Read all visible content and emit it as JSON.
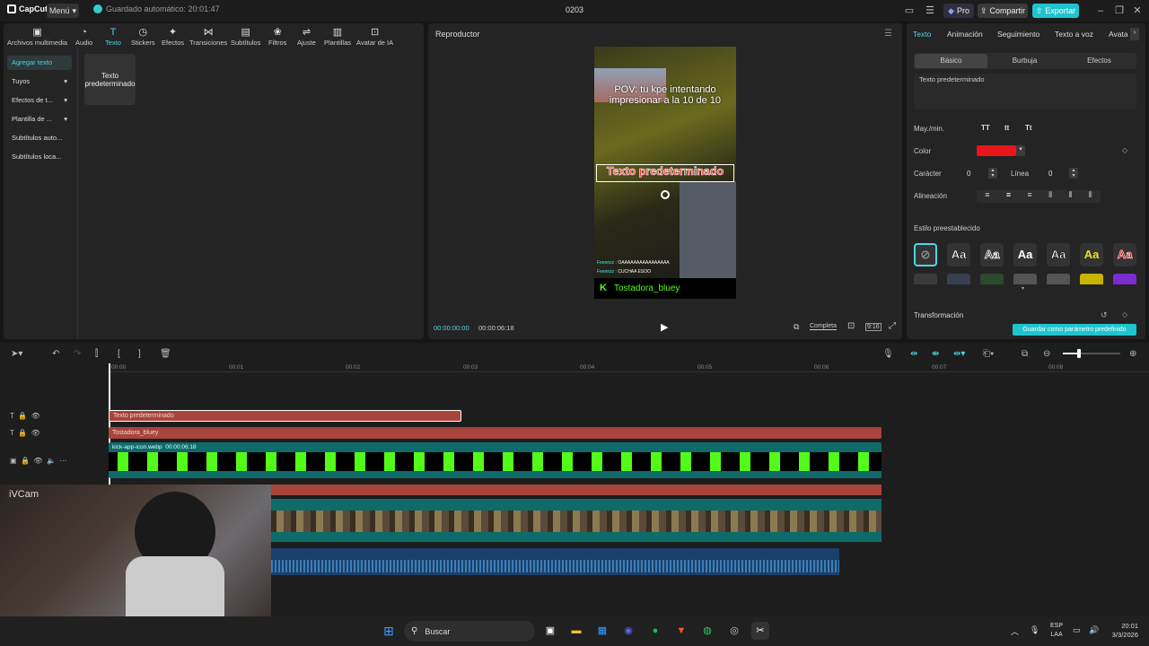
{
  "app": {
    "logo": "CapCut",
    "menu_label": "Menú",
    "autosave": "Guardado automático: 20:01:47",
    "project_name": "0203",
    "pro_label": "Pro",
    "share_label": "Compartir",
    "export_label": "Exportar"
  },
  "toolbar": {
    "items": [
      "Archivos multimedia",
      "Audio",
      "Texto",
      "Stickers",
      "Efectos",
      "Transiciones",
      "Subtítulos",
      "Filtros",
      "Ajuste",
      "Plantillas",
      "Avatar de IA"
    ],
    "active": "Texto"
  },
  "sidebar": {
    "items": [
      "Agregar texto",
      "Tuyos",
      "Efectos de t...",
      "Plantilla de ...",
      "Subtítulos auto...",
      "Subtítulos loca..."
    ]
  },
  "template_card": "Texto predeterminado",
  "player": {
    "title": "Reproductor",
    "current_time": "00:00:00:00",
    "total_time": "00:00:06:18",
    "complete_label": "Completa",
    "ratio_label": "9:16"
  },
  "video": {
    "pov_text": "POV: tu kpe intentando impresionar a la 10 de 10",
    "selected_text": "Texto predeterminado",
    "chat1_user": "Feennzz :",
    "chat1_msg": "OAAAAAAAAAAAAAAAA",
    "chat2_user": "Feennzz :",
    "chat2_msg": "CUCHAA ESOO",
    "channel": "Tostadora_bluey"
  },
  "props": {
    "tabs": [
      "Texto",
      "Animación",
      "Seguimiento",
      "Texto a voz",
      "Avata"
    ],
    "subtabs": [
      "Básico",
      "Burbuja",
      "Efectos"
    ],
    "text_value": "Texto predeterminado",
    "case_label": "May./min.",
    "case_opts": [
      "TT",
      "tt",
      "Tt"
    ],
    "color_label": "Color",
    "color_value": "#e8161a",
    "char_label": "Carácter",
    "char_value": "0",
    "line_label": "Línea",
    "line_value": "0",
    "align_label": "Alineación",
    "preset_label": "Estilo preestablecido",
    "preset_glyph": "Aa",
    "transform_label": "Transformación",
    "save_preset": "Guardar como parámetro predefinido"
  },
  "timeline": {
    "ruler": [
      "00:00",
      "00:01",
      "00:02",
      "00:03",
      "00:04",
      "00:05",
      "00:06",
      "00:07",
      "00:08"
    ],
    "clip_text": "Texto predeterminado",
    "clip_channel": "Tostadora_bluey",
    "clip_image_name": "kick-app-icon.webp",
    "clip_image_dur": "00:00:06:18",
    "webcam_label": "iVCam"
  },
  "taskbar": {
    "search": "Buscar",
    "lang1": "ESP",
    "lang2": "LAA",
    "time": "20:01",
    "date": "3/3/2026"
  }
}
